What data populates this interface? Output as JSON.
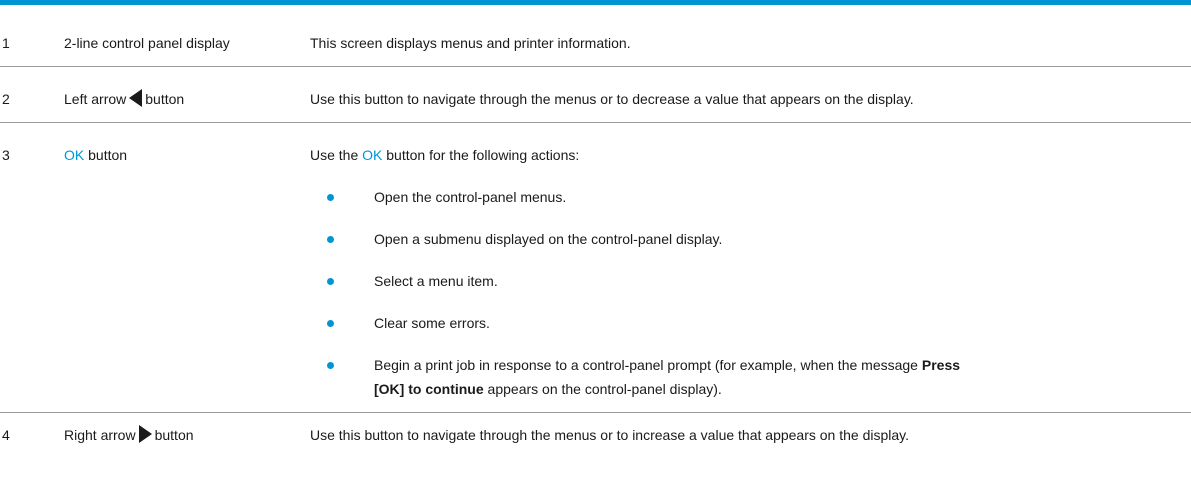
{
  "rows": [
    {
      "number": "1",
      "name": "2-line control panel display",
      "description": "This screen displays menus and printer information."
    },
    {
      "number": "2",
      "name_before": "Left arrow",
      "name_after": "button",
      "arrow_icon": "left-arrow-icon",
      "description": "Use this button to navigate through the menus or to decrease a value that appears on the display."
    },
    {
      "number": "3",
      "name_accent": "OK",
      "name_after": "button",
      "intro_before": "Use the",
      "intro_accent": "OK",
      "intro_after": "button for the following actions:",
      "bullets": [
        "Open the control-panel menus.",
        "Open a submenu displayed on the control-panel display.",
        "Select a menu item.",
        "Clear some errors."
      ],
      "last_bullet": {
        "line1_before": "Begin a print job in response to a control-panel prompt (for example, when the message",
        "line1_bold": "Press",
        "line2_bold": "[OK] to continue",
        "line2_after": "appears on the control-panel display)."
      }
    },
    {
      "number": "4",
      "name_before": "Right arrow",
      "name_after": "button",
      "arrow_icon": "right-arrow-icon",
      "description": "Use this button to navigate through the menus or to increase a value that appears on the display."
    }
  ],
  "colors": {
    "accent": "#0096d6",
    "text": "#1a1a1a",
    "rule": "#9a9a9a"
  }
}
